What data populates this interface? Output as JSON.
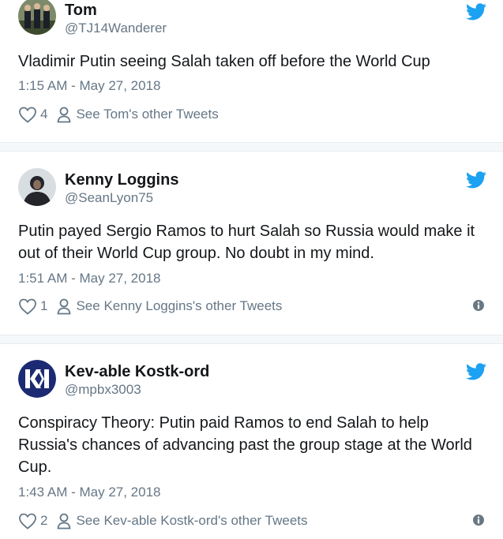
{
  "icons": {
    "avatar_tweet1": "group-photo-avatar",
    "avatar_tweet2": "person-avatar",
    "avatar_tweet3": "kk-logo-avatar",
    "brand": "twitter-bird-icon",
    "like": "heart-outline-icon",
    "profile": "person-outline-icon",
    "info": "info-circle-icon"
  },
  "colors": {
    "twitter_blue": "#1da1f2",
    "text": "#14171a",
    "secondary": "#657786",
    "separator": "#f5f8fa",
    "info_icon": "#697882"
  },
  "tweets": [
    {
      "name": "Tom",
      "handle": "@TJ14Wanderer",
      "text": "Vladimir Putin seeing Salah taken off before the World Cup",
      "time": "1:15 AM - May 27, 2018",
      "likes": "4",
      "other_tweets": "See Tom's other Tweets"
    },
    {
      "name": "Kenny Loggins",
      "handle": "@SeanLyon75",
      "text": "Putin payed Sergio Ramos to hurt Salah so Russia would make it out of their World Cup group. No doubt in my mind.",
      "time": "1:51 AM - May 27, 2018",
      "likes": "1",
      "other_tweets": "See Kenny Loggins's other Tweets"
    },
    {
      "name": "Kev-able Kostk-ord",
      "handle": "@mpbx3003",
      "text": "Conspiracy Theory: Putin paid Ramos to end Salah to help Russia's chances of advancing past the group stage at the World Cup.",
      "time": "1:43 AM - May 27, 2018",
      "likes": "2",
      "other_tweets": "See Kev-able Kostk-ord's other Tweets"
    }
  ]
}
